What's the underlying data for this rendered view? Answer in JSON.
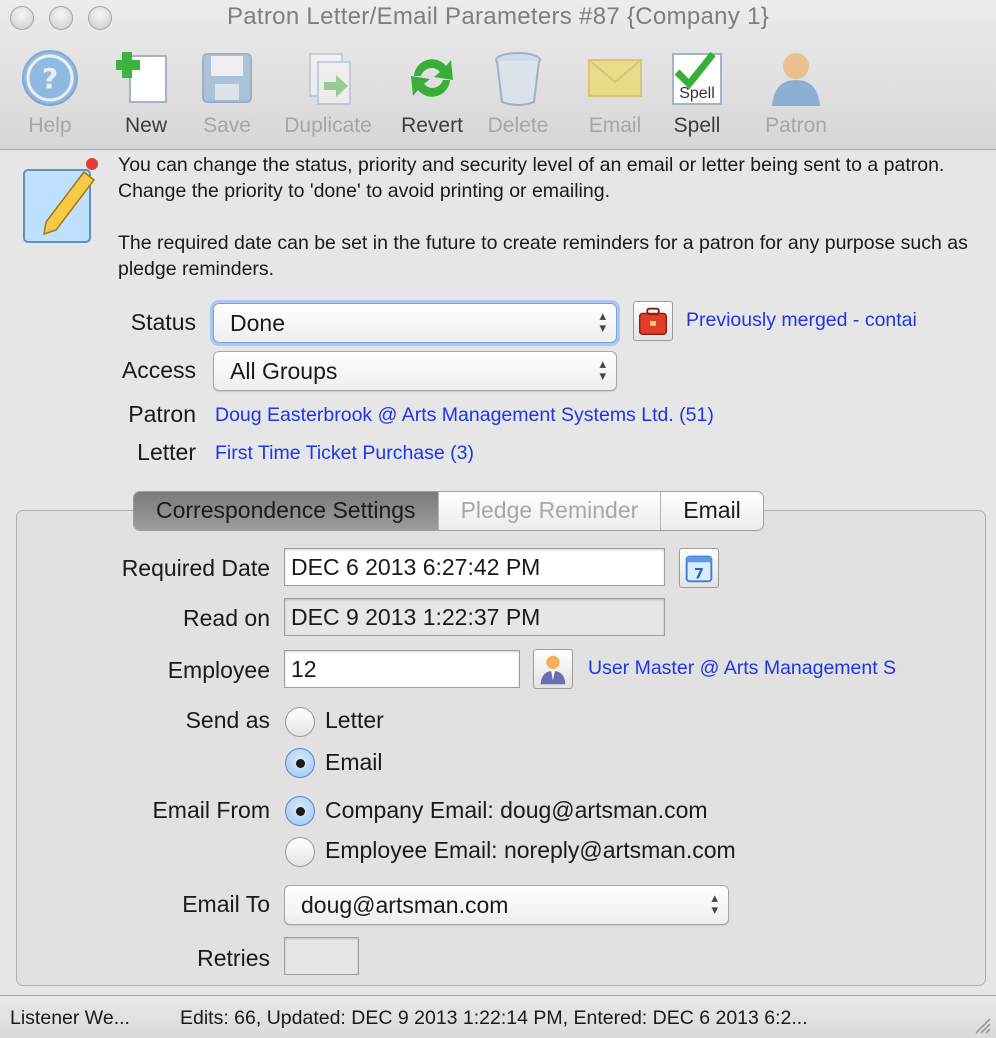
{
  "window": {
    "title": "Patron Letter/Email Parameters #87 {Company 1}"
  },
  "toolbar": {
    "help": "Help",
    "new": "New",
    "save": "Save",
    "duplicate": "Duplicate",
    "revert": "Revert",
    "delete": "Delete",
    "email": "Email",
    "spell": "Spell",
    "spell_icon_text": "Spell",
    "patron": "Patron"
  },
  "info": {
    "paragraph1": "You can change the status, priority and security level of an email or letter being sent to a patron.  Change the priority to 'done' to avoid printing or emailing.",
    "paragraph2": "The required date can be set in the future to create reminders for a patron for any purpose such as pledge reminders."
  },
  "form": {
    "status_label": "Status",
    "status_value": "Done",
    "status_note": "Previously merged - contai",
    "access_label": "Access",
    "access_value": "All Groups",
    "patron_label": "Patron",
    "patron_link": "Doug Easterbrook @ Arts Management Systems Ltd. (51)",
    "letter_label": "Letter",
    "letter_link": "First Time Ticket Purchase (3)"
  },
  "tabs": {
    "correspondence": "Correspondence Settings",
    "pledge": "Pledge Reminder",
    "email": "Email"
  },
  "settings": {
    "required_date_label": "Required Date",
    "required_date_value": "DEC 6 2013 6:27:42 PM",
    "read_on_label": "Read on",
    "read_on_value": "DEC 9 2013 1:22:37 PM",
    "employee_label": "Employee",
    "employee_value": "12",
    "employee_link": "User Master @ Arts Management S",
    "send_as_label": "Send as",
    "send_as_letter": "Letter",
    "send_as_email": "Email",
    "email_from_label": "Email From",
    "email_from_company": "Company Email: doug@artsman.com",
    "email_from_employee": "Employee Email: noreply@artsman.com",
    "email_to_label": "Email To",
    "email_to_value": "doug@artsman.com",
    "retries_label": "Retries",
    "retries_value": ""
  },
  "statusbar": {
    "left": "Listener We...",
    "right": "Edits: 66, Updated: DEC 9 2013 1:22:14 PM, Entered: DEC 6 2013 6:2..."
  },
  "colors": {
    "link": "#1b37e8",
    "focus_ring": "#a9c8ef"
  }
}
